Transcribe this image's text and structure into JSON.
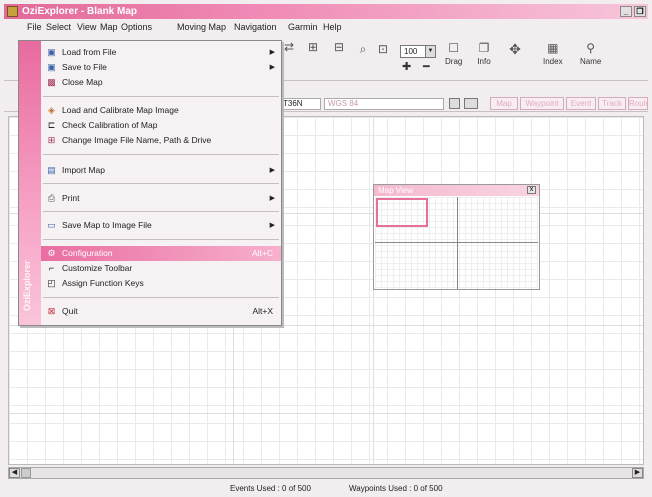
{
  "window": {
    "title": "OziExplorer - Blank Map",
    "controls": [
      "_",
      "❒"
    ]
  },
  "menubar": [
    "File",
    "Select",
    "View",
    "Map",
    "Options",
    "Moving Map",
    "Navigation",
    "Garmin",
    "Help"
  ],
  "toolbar": {
    "zoom_value": "100",
    "tools": [
      {
        "icon": "drag-icon",
        "label": "Drag"
      },
      {
        "icon": "info-icon",
        "label": "Info"
      },
      {
        "icon": "index-icon",
        "label": "Index"
      },
      {
        "icon": "name-icon",
        "label": "Name"
      }
    ]
  },
  "infobar": {
    "position_text": "T36N",
    "datum": "WGS 84",
    "tabs": [
      "Map",
      "Waypoint",
      "Event",
      "Track",
      "Route"
    ]
  },
  "file_menu": {
    "sidebar_text": "OziExplorer",
    "items": [
      {
        "label": "Load from File",
        "icon": "folder-icon",
        "submenu": true
      },
      {
        "label": "Save to File",
        "icon": "disk-icon",
        "submenu": true
      },
      {
        "label": "Close Map",
        "icon": "close-map-icon",
        "submenu": false
      },
      {
        "label": "Load and Calibrate Map Image",
        "icon": "calibrate-icon",
        "submenu": false
      },
      {
        "label": "Check Calibration of Map",
        "icon": "check-icon",
        "submenu": false
      },
      {
        "label": "Change Image File Name, Path & Drive",
        "icon": "change-icon",
        "submenu": false
      },
      {
        "label": "Import Map",
        "icon": "import-icon",
        "submenu": true
      },
      {
        "label": "Print",
        "icon": "print-icon",
        "submenu": true
      },
      {
        "label": "Save Map to Image File",
        "icon": "save-image-icon",
        "submenu": true
      },
      {
        "label": "Configuration",
        "icon": "config-icon",
        "shortcut": "Alt+C",
        "highlighted": true
      },
      {
        "label": "Customize Toolbar",
        "icon": "toolbar-icon"
      },
      {
        "label": "Assign Function Keys",
        "icon": "keys-icon"
      },
      {
        "label": "Quit",
        "icon": "quit-icon",
        "shortcut": "Alt+X"
      }
    ]
  },
  "map_view": {
    "title": "Map View",
    "close": "x"
  },
  "status": {
    "events": "Events Used : 0 of 500",
    "waypoints": "Waypoints Used : 0 of 500"
  },
  "colors": {
    "accent": "#e86a9e",
    "titlebar": "#e26a9a",
    "background": "#f2eef0"
  }
}
